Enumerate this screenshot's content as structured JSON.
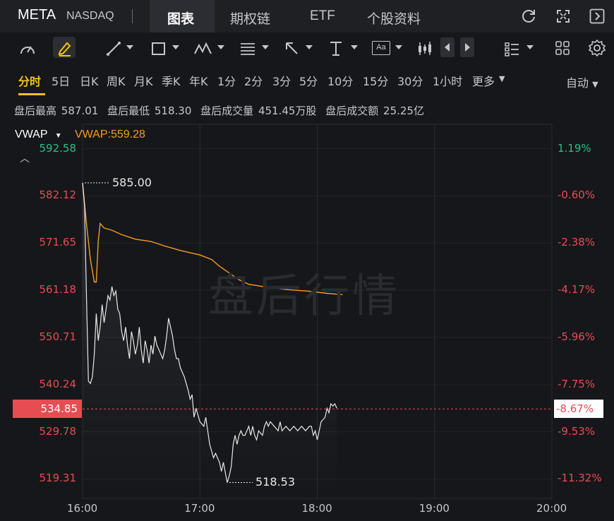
{
  "header": {
    "ticker": "META",
    "exchange": "NASDAQ",
    "tabs": [
      {
        "label": "图表",
        "active": true
      },
      {
        "label": "期权链",
        "active": false
      },
      {
        "label": "ETF",
        "active": false
      },
      {
        "label": "个股资料",
        "active": false
      }
    ],
    "icons": [
      "refresh-icon",
      "fullscreen-icon",
      "collapse-panel-icon"
    ]
  },
  "toolbar": {
    "tools": [
      "indicator-gauge-icon",
      "pen-icon",
      "line-tool-icon",
      "rectangle-tool-icon",
      "pattern-tool-icon",
      "fib-tool-icon",
      "arrow-tool-icon",
      "text-tool-icon",
      "label-tool-icon",
      "candle-tool-icon",
      "prev-icon",
      "next-icon",
      "layout-list-icon",
      "grid-icon",
      "settings-icon"
    ],
    "label_text": "Aa"
  },
  "periods": {
    "items": [
      "分时",
      "5日",
      "日K",
      "周K",
      "月K",
      "季K",
      "年K",
      "1分",
      "2分",
      "3分",
      "5分",
      "10分",
      "15分",
      "30分",
      "1小时",
      "更多"
    ],
    "active": "分时",
    "auto": "自动"
  },
  "stats": {
    "high_label": "盘后最高",
    "high": "587.01",
    "low_label": "盘后最低",
    "low": "518.30",
    "vol_label": "盘后成交量",
    "vol": "451.45万股",
    "amt_label": "盘后成交额",
    "amt": "25.25亿"
  },
  "indicator": {
    "name": "VWAP",
    "value": "VWAP:559.28"
  },
  "watermark": "盘后行情",
  "colors": {
    "up": "#2dbd85",
    "down": "#e64d53",
    "vwap": "#f39c26",
    "price": "#e8e8e8",
    "accent": "#f4c21b"
  },
  "chart_data": {
    "type": "line",
    "y_axis_left": [
      "592.58",
      "582.12",
      "571.65",
      "561.18",
      "550.71",
      "540.24",
      "529.78",
      "519.31"
    ],
    "y_axis_left_values": [
      592.58,
      582.12,
      571.65,
      561.18,
      550.71,
      540.24,
      529.78,
      519.31
    ],
    "y_axis_right": [
      "1.19%",
      "-0.60%",
      "-2.38%",
      "-4.17%",
      "-5.96%",
      "-7.75%",
      "-9.53%",
      "-11.32%"
    ],
    "x_ticks": [
      "16:00",
      "17:00",
      "18:00",
      "19:00",
      "20:00"
    ],
    "x_tick_minutes": [
      0,
      60,
      120,
      180,
      240
    ],
    "current_price": "534.85",
    "current_pct": "-8.67%",
    "high_marker": "585.00",
    "low_marker": "518.53",
    "ylim": [
      515,
      598
    ],
    "xlim_minutes": [
      0,
      240
    ],
    "series": [
      {
        "name": "VWAP",
        "points": [
          [
            0,
            585
          ],
          [
            2,
            576
          ],
          [
            4,
            568
          ],
          [
            6,
            563
          ],
          [
            7,
            563
          ],
          [
            8,
            572
          ],
          [
            9,
            576
          ],
          [
            11,
            575
          ],
          [
            15,
            574.5
          ],
          [
            20,
            573.5
          ],
          [
            27,
            572.5
          ],
          [
            35,
            572
          ],
          [
            42,
            571
          ],
          [
            50,
            570
          ],
          [
            60,
            569
          ],
          [
            66,
            568
          ],
          [
            70,
            566.5
          ],
          [
            75,
            565
          ],
          [
            80,
            563.5
          ],
          [
            85,
            562.5
          ],
          [
            95,
            561.8
          ],
          [
            105,
            561.3
          ],
          [
            115,
            561
          ],
          [
            125,
            560.5
          ],
          [
            133,
            560.2
          ]
        ]
      },
      {
        "name": "Price",
        "points": [
          [
            0,
            585
          ],
          [
            1,
            580
          ],
          [
            2,
            560
          ],
          [
            3,
            541
          ],
          [
            4,
            540.5
          ],
          [
            5,
            542
          ],
          [
            6,
            547
          ],
          [
            7,
            556
          ],
          [
            8,
            550
          ],
          [
            9,
            553
          ],
          [
            10,
            558
          ],
          [
            11,
            554
          ],
          [
            12,
            557
          ],
          [
            13,
            560
          ],
          [
            14,
            559
          ],
          [
            15,
            562
          ],
          [
            16,
            560
          ],
          [
            17,
            561
          ],
          [
            18,
            557
          ],
          [
            19,
            556
          ],
          [
            20,
            552
          ],
          [
            21,
            550
          ],
          [
            22,
            553
          ],
          [
            23,
            549
          ],
          [
            24,
            546
          ],
          [
            25,
            552
          ],
          [
            26,
            550
          ],
          [
            27,
            547
          ],
          [
            28,
            549
          ],
          [
            29,
            553
          ],
          [
            30,
            548
          ],
          [
            31,
            545
          ],
          [
            32,
            550
          ],
          [
            33,
            548
          ],
          [
            34,
            545
          ],
          [
            35,
            549
          ],
          [
            36,
            547
          ],
          [
            37,
            551
          ],
          [
            38,
            549
          ],
          [
            39,
            548
          ],
          [
            40,
            547
          ],
          [
            41,
            546
          ],
          [
            42,
            548
          ],
          [
            43,
            551
          ],
          [
            44,
            555
          ],
          [
            45,
            553
          ],
          [
            46,
            551
          ],
          [
            47,
            548
          ],
          [
            48,
            546
          ],
          [
            49,
            546
          ],
          [
            50,
            544
          ],
          [
            52,
            542
          ],
          [
            54,
            539
          ],
          [
            55,
            537
          ],
          [
            56,
            538
          ],
          [
            57,
            533
          ],
          [
            58,
            535
          ],
          [
            60,
            532
          ],
          [
            62,
            531
          ],
          [
            63,
            533
          ],
          [
            65,
            527
          ],
          [
            67,
            524
          ],
          [
            68,
            525
          ],
          [
            70,
            523
          ],
          [
            71,
            521
          ],
          [
            72,
            523
          ],
          [
            74,
            518.5
          ],
          [
            75,
            520
          ],
          [
            76,
            522
          ],
          [
            77,
            527
          ],
          [
            78,
            529
          ],
          [
            79,
            527
          ],
          [
            80,
            529
          ],
          [
            81,
            530
          ],
          [
            82,
            529
          ],
          [
            83,
            529
          ],
          [
            84,
            530
          ],
          [
            85,
            531
          ],
          [
            86,
            529
          ],
          [
            87,
            531
          ],
          [
            88,
            529
          ],
          [
            89,
            528
          ],
          [
            90,
            530
          ],
          [
            92,
            529
          ],
          [
            93,
            531
          ],
          [
            94,
            532
          ],
          [
            95,
            531
          ],
          [
            96,
            532
          ],
          [
            98,
            531
          ],
          [
            100,
            530
          ],
          [
            101,
            532
          ],
          [
            102,
            530
          ],
          [
            104,
            531
          ],
          [
            106,
            530
          ],
          [
            108,
            531
          ],
          [
            110,
            530
          ],
          [
            112,
            531
          ],
          [
            114,
            530
          ],
          [
            116,
            531
          ],
          [
            117,
            531
          ],
          [
            118,
            529
          ],
          [
            119,
            530
          ],
          [
            120,
            528
          ],
          [
            121,
            530
          ],
          [
            122,
            532
          ],
          [
            124,
            533
          ],
          [
            125,
            535
          ],
          [
            126,
            534
          ],
          [
            127,
            536
          ],
          [
            128,
            535.5
          ],
          [
            129,
            536
          ],
          [
            130,
            535
          ]
        ]
      }
    ]
  }
}
